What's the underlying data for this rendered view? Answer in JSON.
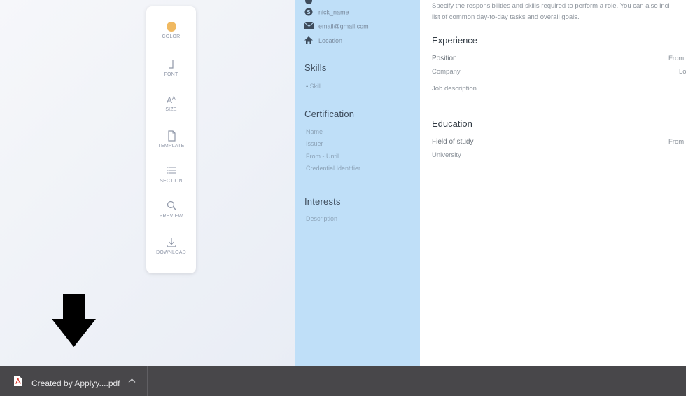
{
  "toolbar": {
    "items": [
      {
        "label": "COLOR",
        "icon": "color-dot-icon",
        "color": "#f0b961"
      },
      {
        "label": "FONT",
        "icon": "font-icon"
      },
      {
        "label": "SIZE",
        "icon": "size-icon"
      },
      {
        "label": "TEMPLATE",
        "icon": "template-icon"
      },
      {
        "label": "SECTION",
        "icon": "section-list-icon"
      },
      {
        "label": "PREVIEW",
        "icon": "magnifier-icon"
      },
      {
        "label": "DOWNLOAD",
        "icon": "download-icon"
      }
    ]
  },
  "resume": {
    "sidebar_color": "#bfdff8",
    "contacts": [
      {
        "icon": "skype-icon",
        "text": "nick_name"
      },
      {
        "icon": "envelope-icon",
        "text": "email@gmail.com"
      },
      {
        "icon": "home-icon",
        "text": "Location"
      }
    ],
    "skills": {
      "heading": "Skills",
      "items": [
        "Skill"
      ]
    },
    "certification": {
      "heading": "Certification",
      "items": [
        "Name",
        "Issuer",
        "From - Until",
        "Credential Identifier"
      ]
    },
    "interests": {
      "heading": "Interests",
      "items": [
        "Description"
      ]
    },
    "main": {
      "intro_line1": "Specify the responsibilities and skills required to perform a role. You can also incl",
      "intro_line2": "list of common day-to-day tasks and overall goals.",
      "experience": {
        "heading": "Experience",
        "position": "Position",
        "from": "From",
        "company": "Company",
        "location": "Lo",
        "job_description": "Job description"
      },
      "education": {
        "heading": "Education",
        "field": "Field of study",
        "from": "From",
        "university": "University"
      }
    }
  },
  "download_bar": {
    "file_name": "Created by Applyy....pdf"
  }
}
